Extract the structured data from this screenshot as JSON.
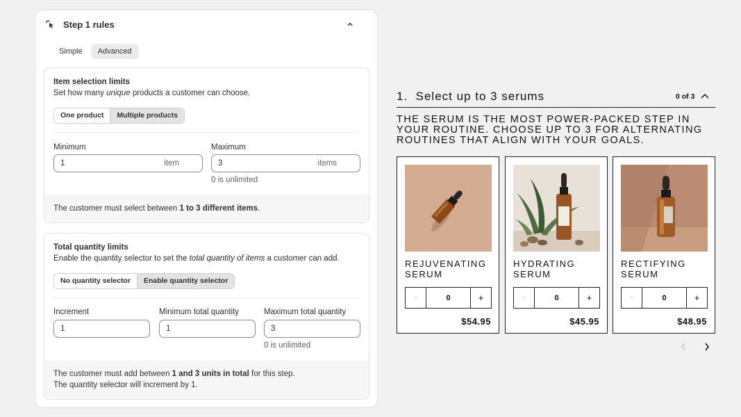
{
  "panel": {
    "title": "Step 1 rules",
    "icons": {
      "header": "cursor-click-icon",
      "collapse": "chevron-up-icon"
    },
    "tabs": [
      {
        "label": "Simple",
        "active": false
      },
      {
        "label": "Advanced",
        "active": true
      }
    ]
  },
  "item_limits": {
    "heading": "Item selection limits",
    "desc_pre": "Set how many ",
    "desc_em": "unique",
    "desc_post": " products a customer can choose.",
    "options": [
      {
        "label": "One product",
        "selected": false
      },
      {
        "label": "Multiple products",
        "selected": true
      }
    ],
    "min": {
      "label": "Minimum",
      "value": "1",
      "suffix": "item"
    },
    "max": {
      "label": "Maximum",
      "value": "3",
      "suffix": "items",
      "help": "0 is unlimited"
    },
    "summary": {
      "pre": "The customer must select between ",
      "bold": "1 to 3 different items",
      "post": "."
    }
  },
  "qty_limits": {
    "heading": "Total quantity limits",
    "desc_pre": "Enable the quantity selector to set the ",
    "desc_em": "total quantity of items",
    "desc_post": " a customer can add.",
    "options": [
      {
        "label": "No quantity selector",
        "selected": false
      },
      {
        "label": "Enable quantity selector",
        "selected": true
      }
    ],
    "increment": {
      "label": "Increment",
      "value": "1"
    },
    "min_total": {
      "label": "Minimum total quantity",
      "value": "1"
    },
    "max_total": {
      "label": "Maximum total quantity",
      "value": "3",
      "help": "0 is unlimited"
    },
    "summary": {
      "line1_pre": "The customer must add between ",
      "line1_bold": "1 and 3 units in total",
      "line1_post": " for this step.",
      "line2": "The quantity selector will increment by 1."
    }
  },
  "widget": {
    "step_title": "1.  Select up to 3 serums",
    "count": "0 of 3",
    "description": "The serum is the most power-packed step in your routine. Choose up to 3 for alternating routines that align with your goals.",
    "products": [
      {
        "name": "Rejuvenating Serum",
        "qty": "0",
        "price": "$54.95",
        "minus": "-",
        "plus": "+",
        "image": "amber-dropper-bottle-lying-on-beige"
      },
      {
        "name": "Hydrating Serum",
        "qty": "0",
        "price": "$45.95",
        "minus": "-",
        "plus": "+",
        "image": "dropper-bottle-with-palm-leaves-and-stones"
      },
      {
        "name": "Rectifying Serum",
        "qty": "0",
        "price": "$48.95",
        "minus": "-",
        "plus": "+",
        "image": "amber-dropper-bottle-standing-on-terracotta"
      }
    ],
    "icons": {
      "prev": "chevron-left-icon",
      "next": "chevron-right-icon",
      "collapse": "chevron-up-icon"
    }
  },
  "colors": {
    "text": "#303030",
    "selected_segment": "#e3e3e3",
    "border": "#8a8a8a",
    "widget_ink": "#111111"
  }
}
